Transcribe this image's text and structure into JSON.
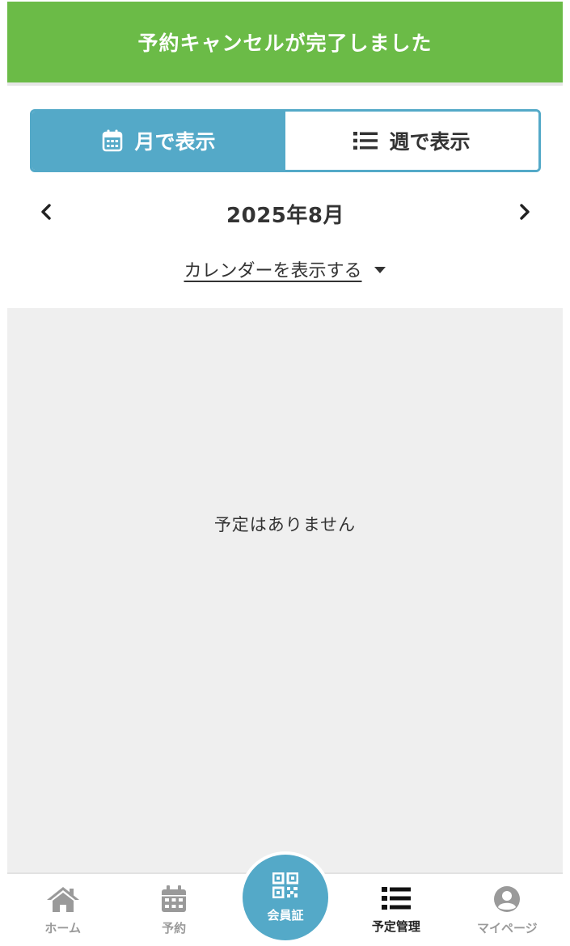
{
  "banner": {
    "message": "予約キャンセルが完了しました"
  },
  "view_toggle": {
    "month_label": "月で表示",
    "week_label": "週で表示",
    "active": "month"
  },
  "month_nav": {
    "current": "2025年8月",
    "prev_icon": "chevron-left-icon",
    "next_icon": "chevron-right-icon"
  },
  "calendar_toggle": {
    "label": "カレンダーを表示する",
    "icon": "caret-down-icon"
  },
  "schedule": {
    "empty_message": "予定はありません"
  },
  "bottom_nav": {
    "items": [
      {
        "label": "ホーム",
        "icon": "home-icon",
        "active": false
      },
      {
        "label": "予約",
        "icon": "calendar-icon",
        "active": false
      },
      {
        "label": "会員証",
        "icon": "qr-code-icon",
        "active": false
      },
      {
        "label": "予定管理",
        "icon": "list-icon",
        "active": true
      },
      {
        "label": "マイページ",
        "icon": "user-icon",
        "active": false
      }
    ]
  },
  "colors": {
    "banner_green": "#6bbb47",
    "accent_blue": "#54a9c8",
    "text_dark": "#333333",
    "nav_gray": "#9a9a9a",
    "area_gray": "#efefef"
  }
}
